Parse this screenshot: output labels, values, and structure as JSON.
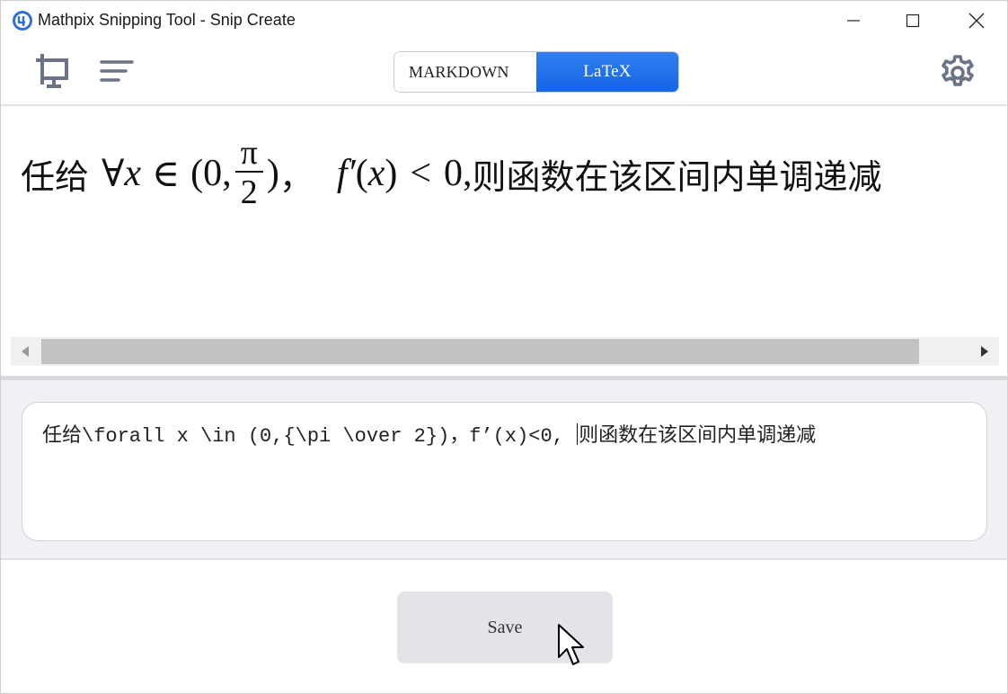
{
  "window": {
    "title": "Mathpix Snipping Tool - Snip Create",
    "icons": [
      "mathpix-logo-icon",
      "minimize-icon",
      "maximize-icon",
      "close-icon"
    ]
  },
  "toolbar": {
    "icons": [
      "snip-screen-icon",
      "menu-lines-icon",
      "gear-icon"
    ],
    "format_tabs": [
      {
        "label": "MARKDOWN",
        "selected": false
      },
      {
        "label": "LaTeX",
        "selected": true
      }
    ],
    "accent_color": "#1565e6"
  },
  "preview": {
    "cjk_prefix": "任给",
    "forall": "∀",
    "var_x": "x",
    "in": "∈",
    "open_paren": "(",
    "zero": "0,",
    "frac_num": "π",
    "frac_den": "2",
    "close_paren": ")",
    "cjk_comma": "，",
    "f_prime": "f′",
    "arg_open": "(",
    "arg_x": "x",
    "arg_close": ")",
    "less_than": "<",
    "zero_comma": "0,",
    "cjk_suffix": "则函数在该区间内单调递减"
  },
  "editor": {
    "text_before_caret": "任给\\forall x \\in (0,{\\pi \\over 2})，f’(x)<0, ",
    "text_after_caret": "则函数在该区间内单调递减"
  },
  "footer": {
    "save_label": "Save"
  }
}
